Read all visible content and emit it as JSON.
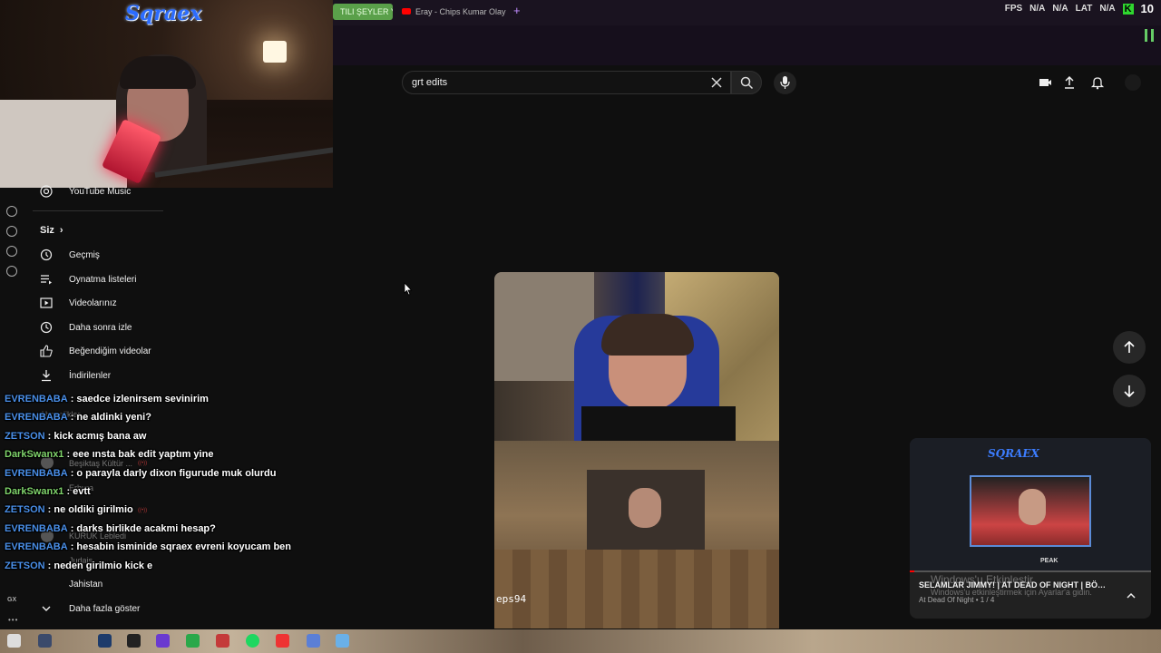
{
  "browser": {
    "tabs": [
      {
        "label": "TILI ŞEYLER YA"
      },
      {
        "label": "Eray - Chips Kumar Olayı"
      }
    ],
    "new_tab": "+",
    "stats": {
      "fps_label": "FPS",
      "fps_value": "N/A",
      "na2": "N/A",
      "lat_label": "LAT",
      "lat_value": "N/A",
      "kick_badge": "K",
      "viewers": "10"
    }
  },
  "webcam": {
    "logo": "Sqraex"
  },
  "search": {
    "value": "grt edits"
  },
  "sidebar": {
    "youtube_music": "YouTube Music",
    "siz": "Siz",
    "chevron": "›",
    "items": [
      {
        "label": "Geçmiş",
        "icon": "history-icon"
      },
      {
        "label": "Oynatma listeleri",
        "icon": "playlist-icon"
      },
      {
        "label": "Videolarınız",
        "icon": "your-videos-icon"
      },
      {
        "label": "Daha sonra izle",
        "icon": "watch-later-icon"
      },
      {
        "label": "Beğendiğim videolar",
        "icon": "like-icon"
      },
      {
        "label": "İndirilenler",
        "icon": "download-icon"
      }
    ],
    "abonelikler": "Abonelikler",
    "channels": [
      "Beşiktaş Kültür ...",
      "Erhura",
      "KURUK Lebledi",
      "Judais"
    ],
    "jahistan": "Jahistan",
    "more": "Daha fazla göster",
    "gx": "GX",
    "dots": "•••"
  },
  "chat": [
    {
      "user": "EVRENBABA",
      "color": "#4a8fe8",
      "text": ": saedce izlenirsem sevinirim"
    },
    {
      "user": "EVRENBABA",
      "color": "#4a8fe8",
      "text": ": ne aldinki yeni?"
    },
    {
      "user": "ZETSON",
      "color": "#4a8fe8",
      "text": ": kick acmış bana aw"
    },
    {
      "user": "DarkSwanx1",
      "color": "#7fd36b",
      "text": ": eee ınsta bak edit yaptım yine"
    },
    {
      "user": "EVRENBABA",
      "color": "#4a8fe8",
      "text": ": o parayla darly dixon figurude muk olurdu"
    },
    {
      "user": "DarkSwanx1",
      "color": "#7fd36b",
      "text": ": evtt"
    },
    {
      "user": "ZETSON",
      "color": "#4a8fe8",
      "text": ": ne oldiki girilmio"
    },
    {
      "user": "EVRENBABA",
      "color": "#4a8fe8",
      "text": ": darks birlikde acakmi hesap?"
    },
    {
      "user": "EVRENBABA",
      "color": "#4a8fe8",
      "text": ": hesabin isminide sqraex evreni koyucam ben"
    },
    {
      "user": "ZETSON",
      "color": "#4a8fe8",
      "text": ": neden girilmio kick e"
    }
  ],
  "video": {
    "overlay_tag": "eps94"
  },
  "miniplayer": {
    "logo": "SQRAEX",
    "peak": "PEAK",
    "title": "SELAMLAR JIMMY! | AT DEAD OF NIGHT | BÖLÜM",
    "subtitle": "At Dead Of Night • 1 / 4",
    "progress": 0.02
  },
  "windows_notice": {
    "title": "Windows'u Etkinleştir",
    "text": "Windows'u etkinleştirmek için Ayarlar'a gidin."
  }
}
